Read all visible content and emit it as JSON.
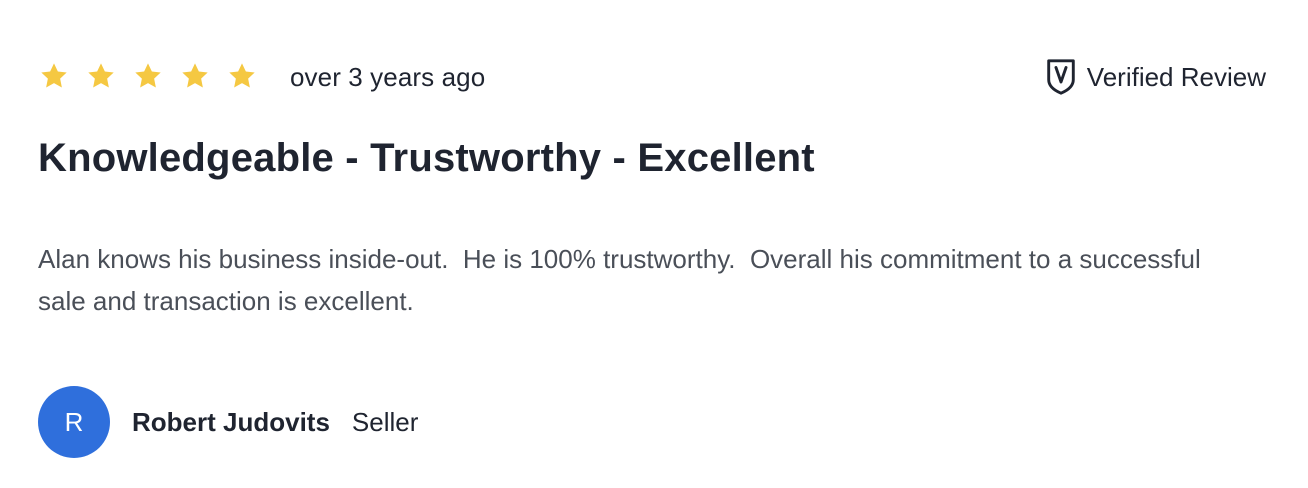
{
  "review": {
    "rating": 5,
    "rating_max": 5,
    "star_color": "#f5c842",
    "date": "over 3 years ago",
    "verified_label": "Verified Review",
    "verified_icon": "shield-check-icon",
    "title": "Knowledgeable - Trustworthy - Excellent",
    "body": "Alan knows his business inside-out.  He is 100% trustworthy.  Overall his commitment to a successful sale and transaction is excellent.",
    "reviewer": {
      "initial": "R",
      "avatar_color": "#2f6fdc",
      "name": "Robert Judovits",
      "role": "Seller"
    }
  }
}
